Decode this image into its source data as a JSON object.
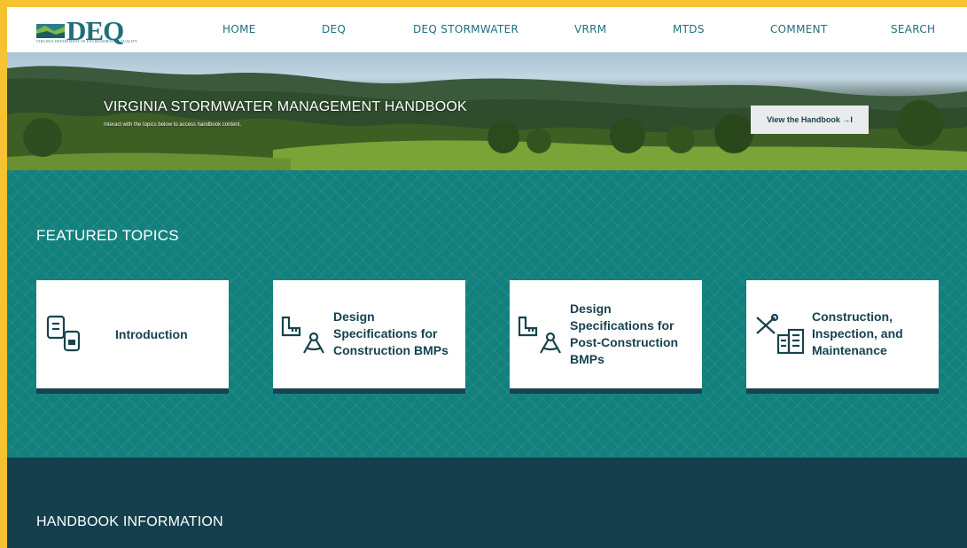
{
  "logo": {
    "text": "DEQ",
    "subtitle": "VIRGINIA DEPARTMENT OF ENVIRONMENTAL QUALITY"
  },
  "nav": {
    "items": [
      "HOME",
      "DEQ",
      "DEQ STORMWATER",
      "VRRM",
      "MTDS",
      "COMMENT",
      "SEARCH"
    ]
  },
  "hero": {
    "title": "VIRGINIA STORMWATER MANAGEMENT HANDBOOK",
    "subtitle": "Interact with the topics below to access handbook content.",
    "button_label": "View the Handbook →I"
  },
  "featured": {
    "title": "FEATURED TOPICS",
    "cards": [
      {
        "label": "Introduction",
        "icon": "documents-icon"
      },
      {
        "label": "Design Specifications for Construction BMPs",
        "icon": "ruler-compass-icon"
      },
      {
        "label": "Design Specifications for Post-Construction BMPs",
        "icon": "ruler-compass-icon"
      },
      {
        "label": "Construction, Inspection, and Maintenance",
        "icon": "tools-building-icon"
      }
    ]
  },
  "info": {
    "title": "HANDBOOK INFORMATION"
  },
  "colors": {
    "accent": "#12807c",
    "dark": "#153f4d",
    "border": "#f6c232"
  }
}
